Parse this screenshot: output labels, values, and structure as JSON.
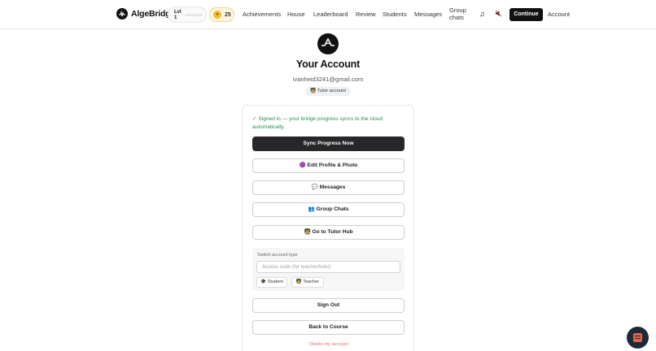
{
  "nav": {
    "brand": "AlgeBridge",
    "level_label": "Lvl 1",
    "level_progress": 0,
    "coins": "25",
    "links": [
      "Achievements",
      "House",
      "Leaderboard",
      "Review",
      "Students",
      "Messages",
      "Group chats"
    ],
    "music_icon": "music-note-icon",
    "mute_icon": "speaker-muted-icon",
    "continue_label": "Continue",
    "account_label": "Account"
  },
  "header": {
    "title": "Your Account",
    "email": "ivanheid3241@gmail.com",
    "role_badge": "🧑‍🏫 Tutor account"
  },
  "card": {
    "signed_note": "✓ Signed in — your bridge progress syncs to the cloud automatically.",
    "sync_button": "Sync Progress Now",
    "edit_profile_button": "🟣 Edit Profile & Photo",
    "messages_button": "💬 Messages",
    "group_chats_button": "👥 Group Chats",
    "tutor_hub_button": "🧑‍🏫 Go to Tutor Hub",
    "switch": {
      "label": "Switch account type",
      "code_value": "",
      "code_placeholder": "Access code (for teacher/tutor)",
      "student_option": "🎓 Student",
      "teacher_option": "🧑‍🏫 Teacher"
    },
    "sign_out_button": "Sign Out",
    "back_button": "Back to Course",
    "delete_link": "Delete my account"
  },
  "colors": {
    "primary": "#27272a",
    "success_text": "#2e8b57",
    "danger_text": "#ef6b6b",
    "coin": "#f5b92d"
  }
}
